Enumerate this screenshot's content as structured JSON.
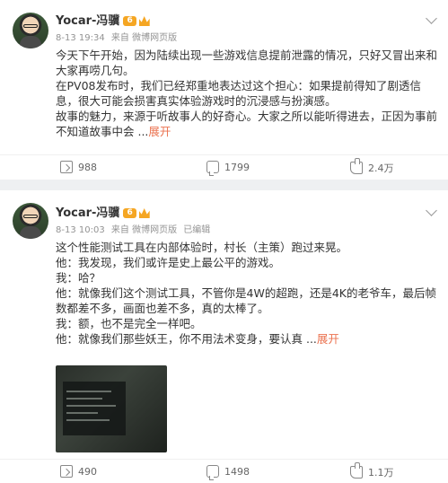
{
  "posts": [
    {
      "author": "Yocar-冯骥",
      "badge": "6",
      "time": "8-13 19:34",
      "source": "来自 微博网页版",
      "edited": "",
      "paragraphs": [
        "今天下午开始，因为陆续出现一些游戏信息提前泄露的情况，只好又冒出来和大家再唠几句。",
        "在PV08发布时，我们已经郑重地表达过这个担心：如果提前得知了剧透信息，很大可能会损害真实体验游戏时的沉浸感与扮演感。",
        "故事的魅力，来源于听故事人的好奇心。大家之所以能听得进去，正因为事前不知道故事中会 ..."
      ],
      "expand": "展开",
      "reposts": "988",
      "comments": "1799",
      "likes": "2.4万"
    },
    {
      "author": "Yocar-冯骥",
      "badge": "6",
      "time": "8-13 10:03",
      "source": "来自 微博网页版",
      "edited": "已编辑",
      "paragraphs": [
        "这个性能测试工具在内部体验时，村长（主策）跑过来晃。",
        "他：我发现，我们或许是史上最公平的游戏。",
        "我：哈？",
        "他：就像我们这个测试工具，不管你是4W的超跑，还是4K的老爷车，最后帧数都差不多，画面也差不多，真的太棒了。",
        "我：额，也不是完全一样吧。",
        "他：就像我们那些妖王，你不用法术变身，要认真 ..."
      ],
      "expand": "展开",
      "reposts": "490",
      "comments": "1498",
      "likes": "1.1万"
    }
  ]
}
